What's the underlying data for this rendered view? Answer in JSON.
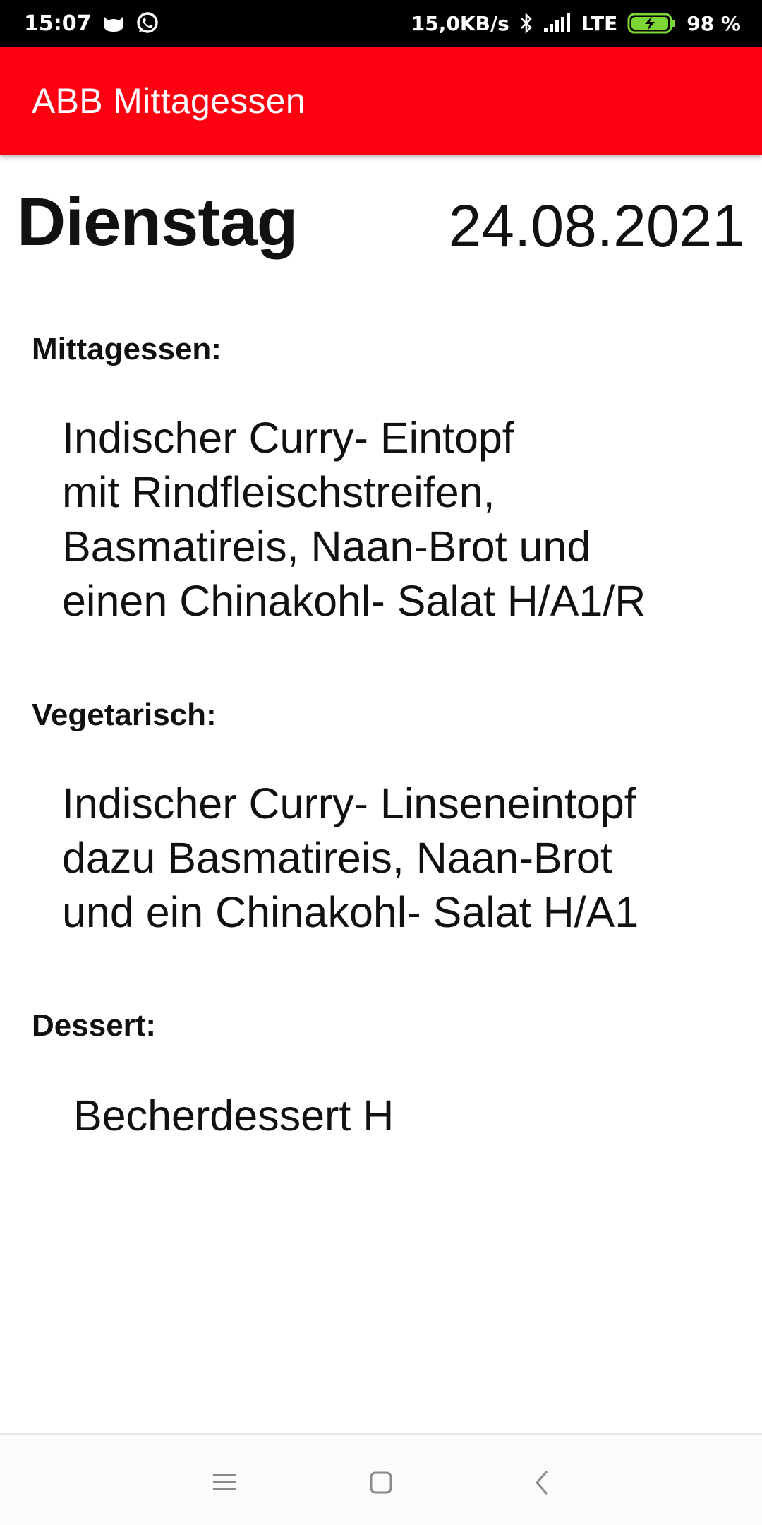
{
  "status_bar": {
    "time": "15:07",
    "network_speed": "15,0KB/s",
    "network_type": "LTE",
    "battery": "98 %",
    "icons": [
      "cat-notification-icon",
      "whatsapp-icon",
      "bluetooth-icon",
      "signal-icon",
      "battery-charging-icon"
    ]
  },
  "app_bar": {
    "title": "ABB Mittagessen",
    "color": "#ff0010"
  },
  "day": {
    "name": "Dienstag",
    "date": "24.08.2021"
  },
  "sections": {
    "main": {
      "label": "Mittagessen:",
      "lines": [
        "Indischer Curry- Eintopf",
        "mit Rindfleischstreifen,",
        "Basmatireis, Naan-Brot und",
        "einen Chinakohl- Salat H/A1/R"
      ]
    },
    "vegetarian": {
      "label": "Vegetarisch:",
      "lines": [
        "Indischer Curry- Linseneintopf",
        "dazu Basmatireis, Naan-Brot",
        "und ein Chinakohl- Salat H/A1"
      ]
    },
    "dessert": {
      "label": "Dessert:",
      "lines": [
        "Becherdessert H"
      ]
    }
  },
  "nav_bar": {
    "icons": [
      "menu-icon",
      "home-icon",
      "back-icon"
    ]
  }
}
